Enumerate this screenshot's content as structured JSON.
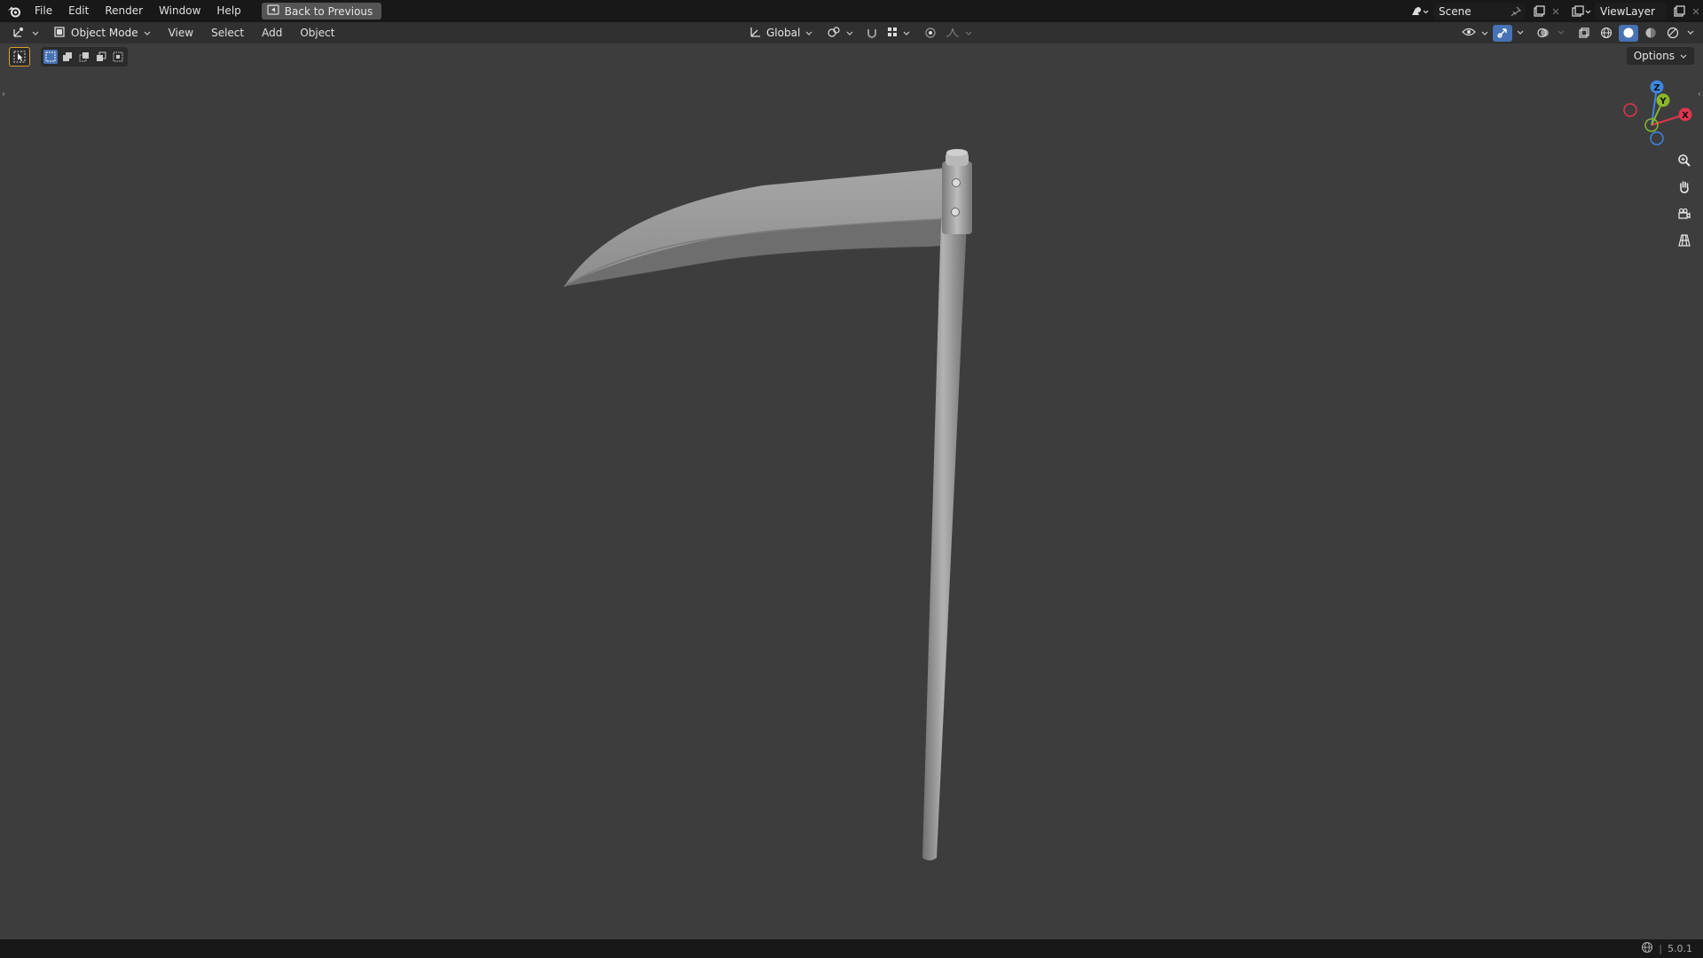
{
  "topbar": {
    "menu": [
      "File",
      "Edit",
      "Render",
      "Window",
      "Help"
    ],
    "back_button": "Back to Previous",
    "scene_name": "Scene",
    "view_layer": "ViewLayer"
  },
  "header": {
    "mode": "Object Mode",
    "menus": [
      "View",
      "Select",
      "Add",
      "Object"
    ],
    "transform_orientation": "Global",
    "options_label": "Options"
  },
  "status": {
    "version": "5.0.1"
  },
  "colors": {
    "viewport_bg": "#3d3d3d",
    "header_bg": "#303030",
    "topbar_bg": "#181818",
    "axis_x": "#e0354d",
    "axis_y": "#89b62a",
    "axis_z": "#3d86e0",
    "accent": "#4772b3"
  }
}
